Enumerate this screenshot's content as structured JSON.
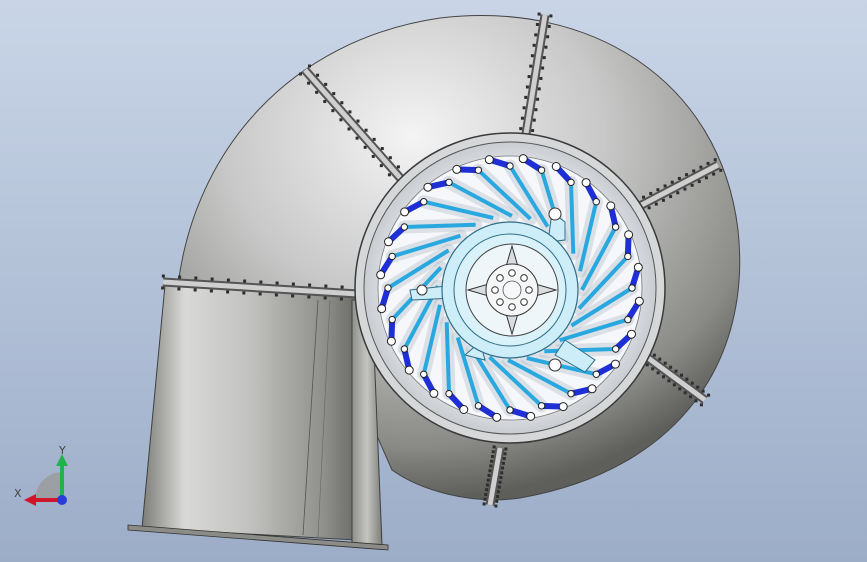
{
  "viewport": {
    "background_top": "#c7d3e6",
    "background_bottom": "#9dafc9"
  },
  "model": {
    "casing_color": "#bfbfbf",
    "casing_dark": "#6f6f6f",
    "guide_vane_color": "#29a8e0",
    "servo_color": "#1f2fd6",
    "stay_ring_color": "#d8ecf4",
    "guide_vane_count": 24
  },
  "triad": {
    "x_label": "X",
    "y_label": "Y",
    "x_color": "#d0142a",
    "y_color": "#22b14c",
    "origin_color": "#2b3bd6"
  }
}
